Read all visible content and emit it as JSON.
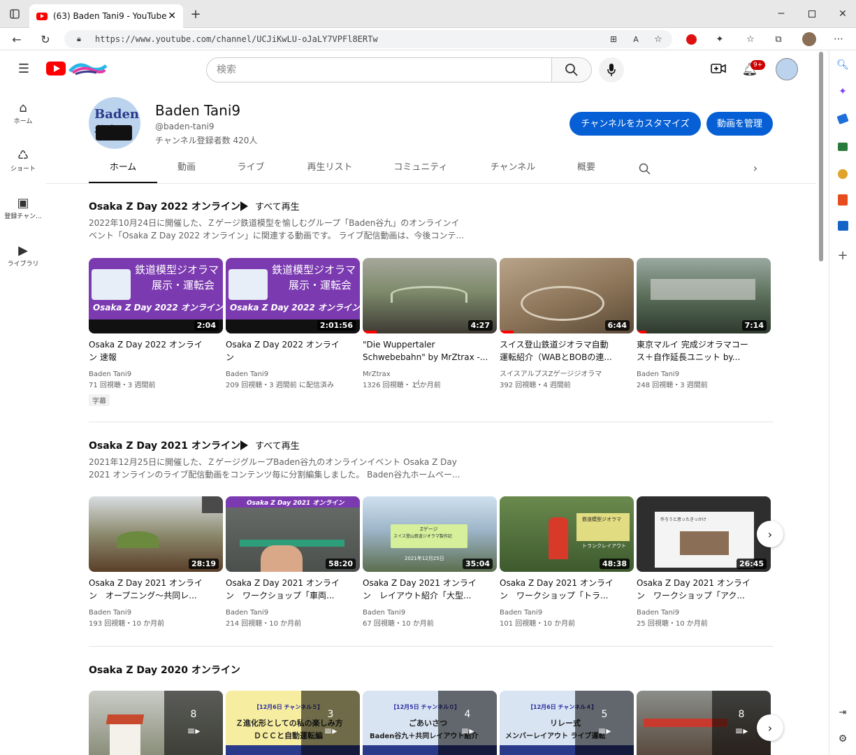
{
  "browser": {
    "tab_title": "(63) Baden Tani9 - YouTube",
    "url": "https://www.youtube.com/channel/UCJiKwLU-oJaLY7VPFl8ERTw"
  },
  "yt": {
    "search_placeholder": "検索",
    "notification_badge": "9+",
    "guide": [
      {
        "label": "ホーム",
        "icon": "home-icon"
      },
      {
        "label": "ショート",
        "icon": "shorts-icon"
      },
      {
        "label": "登録チャン...",
        "icon": "subscriptions-icon"
      },
      {
        "label": "ライブラリ",
        "icon": "library-icon"
      }
    ]
  },
  "channel": {
    "name": "Baden Tani9",
    "handle": "@baden-tani9",
    "subscribers": "チャンネル登録者数 420人",
    "customize_label": "チャンネルをカスタマイズ",
    "manage_label": "動画を管理",
    "avatar_text": "Baden谷九"
  },
  "tabs": [
    "ホーム",
    "動画",
    "ライブ",
    "再生リスト",
    "コミュニティ",
    "チャンネル",
    "概要"
  ],
  "sections": [
    {
      "title": "Osaka Z Day 2022 オンライン",
      "play_all": "すべて再生",
      "desc_line1": "2022年10月24日に開催した、Ｚゲージ鉄道模型を愉しむグループ「Baden谷九」のオンラインイ",
      "desc_line2": "ベント「Osaka Z Day 2022 オンライン」に関連する動画です。 ライブ配信動画は、今後コンテ...",
      "videos": [
        {
          "duration": "2:04",
          "title1": "Osaka Z Day 2022 オンライ",
          "title2": "ン 速報",
          "channel": "Baden Tani9",
          "meta": "71 回視聴・3 週間前",
          "badge": "字幕",
          "thumb_text1": "鉄道模型ジオラマ",
          "thumb_text2": "展示・運転会",
          "thumb_text3": "Osaka Z Day 2022 オンライン"
        },
        {
          "duration": "2:01:56",
          "title1": "Osaka Z Day 2022 オンライ",
          "title2": "ン",
          "channel": "Baden Tani9",
          "meta": "209 回視聴・3 週間前 に配信済み",
          "thumb_text1": "鉄道模型ジオラマ",
          "thumb_text2": "展示・運転会",
          "thumb_text3": "Osaka Z Day 2022 オンライン"
        },
        {
          "duration": "4:27",
          "title1": "\"Die Wuppertaler",
          "title2": "Schwebebahn\" by MrZtrax -...",
          "channel": "MrZtrax",
          "meta": "1326 回視聴・１ か月前"
        },
        {
          "duration": "6:44",
          "title1": "スイス登山鉄道ジオラマ自動",
          "title2": "運転紹介（WABとBOBの連...",
          "channel": "スイスアルプスZゲージジオラマ",
          "meta": "392 回視聴・4 週間前"
        },
        {
          "duration": "7:14",
          "title1": "東京マルイ 完成ジオラマコー",
          "title2": "ス＋自作延長ユニット by...",
          "channel": "Baden Tani9",
          "meta": "248 回視聴・3 週間前"
        }
      ]
    },
    {
      "title": "Osaka Z Day 2021 オンライン",
      "play_all": "すべて再生",
      "desc_line1": "2021年12月25日に開催した、ＺゲージグループBaden谷九のオンラインイベント Osaka Z Day",
      "desc_line2": "2021 オンラインのライブ配信動画をコンテンツ毎に分割編集しました。 Baden谷九ホームペー...",
      "videos": [
        {
          "duration": "28:19",
          "title1": "Osaka Z Day 2021 オンライ",
          "title2": "ン　オープニング～共同レ...",
          "channel": "Baden Tani9",
          "meta": "193 回視聴・10 か月前"
        },
        {
          "duration": "58:20",
          "title1": "Osaka Z Day 2021 オンライ",
          "title2": "ン　ワークショップ「車両...",
          "channel": "Baden Tani9",
          "meta": "214 回視聴・10 か月前",
          "thumb_text1": "Osaka Z Day 2021 オンライン"
        },
        {
          "duration": "35:04",
          "title1": "Osaka Z Day 2021 オンライ",
          "title2": "ン　レイアウト紹介「大型...",
          "channel": "Baden Tani9",
          "meta": "67 回視聴・10 か月前",
          "thumb_text1": "Zゲージ",
          "thumb_text2": "スイス登山鉄道ジオラマ製作記",
          "thumb_text3": "2021年12月25日"
        },
        {
          "duration": "48:38",
          "title1": "Osaka Z Day 2021 オンライ",
          "title2": "ン　ワークショップ「トラ...",
          "channel": "Baden Tani9",
          "meta": "101 回視聴・10 か月前",
          "thumb_text1": "鉄道模型ジオラマ",
          "thumb_text2": "トランクレイアウト"
        },
        {
          "duration": "26:45",
          "title1": "Osaka Z Day 2021 オンライ",
          "title2": "ン　ワークショップ「アク...",
          "channel": "Baden Tani9",
          "meta": "25 回視聴・10 か月前",
          "thumb_text1": "作ろうと思ったきっかけ"
        }
      ]
    },
    {
      "title": "Osaka Z Day 2020 オンライン",
      "playlists": [
        {
          "count": "8"
        },
        {
          "count": "3",
          "thumb_text1": "【12月6日 チャンネル５】",
          "thumb_text2": "Ｚ進化形としての私の楽しみ方",
          "thumb_text3": "ＤＣＣと自動運転編"
        },
        {
          "count": "4",
          "thumb_text1": "【12月5日 チャンネル０】",
          "thumb_text2": "ごあいさつ",
          "thumb_text3": "Baden谷九＋共同レイアウト紹介"
        },
        {
          "count": "5",
          "thumb_text1": "【12月6日 チャンネル４】",
          "thumb_text2": "リレー式",
          "thumb_text3": "メンバーレイアウト ライブ運転"
        },
        {
          "count": "8"
        }
      ]
    }
  ],
  "colors": {
    "accent": "#065fd4",
    "youtube_red": "#ff0000",
    "thumb_purple": "#7b3ab0"
  }
}
